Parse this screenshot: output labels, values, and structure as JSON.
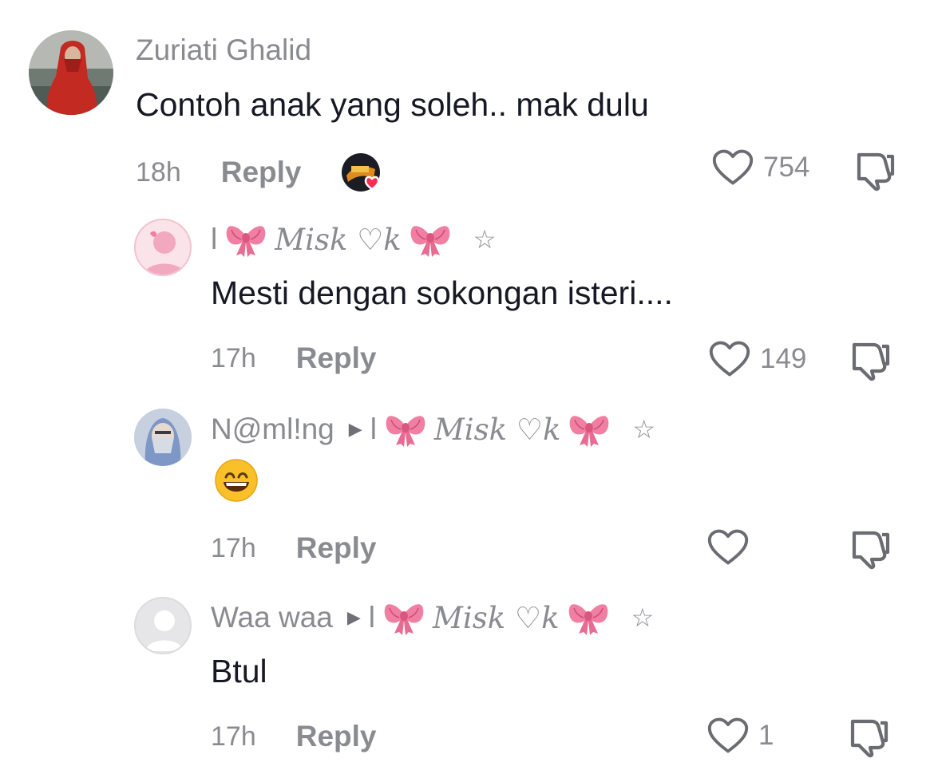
{
  "comments": [
    {
      "username": "Zuriati Ghalid",
      "text": "Contoh anak yang soleh.. mak dulu",
      "time": "18h",
      "reply_label": "Reply",
      "likes": "754"
    },
    {
      "username_prefix": "l",
      "mask_name": "Misk ♡k",
      "star": "☆",
      "text": "Mesti dengan sokongan isteri....",
      "time": "17h",
      "reply_label": "Reply",
      "likes": "149"
    },
    {
      "username": "N@ml!ng",
      "reply_to_prefix": "l",
      "mask_name": "Misk ♡k",
      "star": "☆",
      "text": "😄",
      "time": "17h",
      "reply_label": "Reply",
      "likes": ""
    },
    {
      "username": "Waa waa",
      "reply_to_prefix": "l",
      "mask_name": "Misk ♡k",
      "star": "☆",
      "text": "Btul",
      "time": "17h",
      "reply_label": "Reply",
      "likes": "1"
    }
  ],
  "icons": {
    "like": "heart-outline-icon",
    "dislike": "thumbs-down-icon",
    "reply_arrow": "play-triangle-icon",
    "bow": "pink-ribbon-bow"
  },
  "colors": {
    "muted": "#8a8b91",
    "text": "#161823",
    "bow_pink": "#ee7fa0",
    "like_badge": "#fe2c55"
  }
}
